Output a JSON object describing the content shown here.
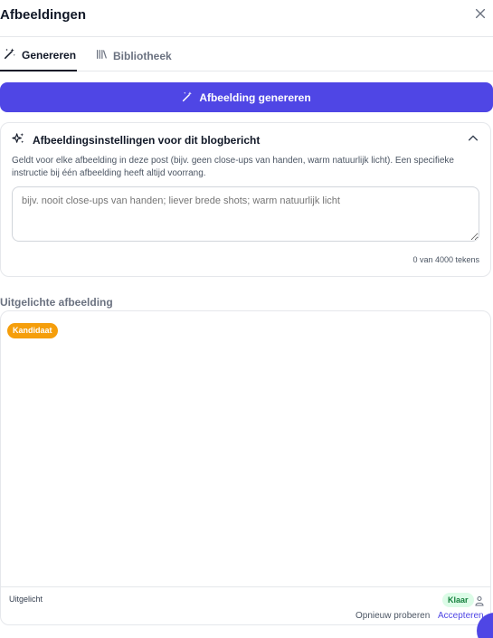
{
  "header": {
    "title": "Afbeeldingen",
    "close_icon": "close-icon"
  },
  "tabs": [
    {
      "label": "Genereren",
      "icon": "wand-icon",
      "active": true
    },
    {
      "label": "Bibliotheek",
      "icon": "library-icon",
      "active": false
    }
  ],
  "generate_button": {
    "label": "Afbeelding genereren",
    "icon": "wand-icon"
  },
  "settings": {
    "title": "Afbeeldingsinstellingen voor dit blogbericht",
    "icon": "sparkles-icon",
    "description": "Geldt voor elke afbeelding in deze post (bijv. geen close-ups van handen, warm natuurlijk licht). Een specifieke instructie bij één afbeelding heeft altijd voorrang.",
    "input_value": "",
    "input_placeholder": "bijv. nooit close-ups van handen; liever brede shots; warm natuurlijk licht",
    "char_count": "0 van 4000 tekens"
  },
  "featured": {
    "section_label": "Uitgelichte afbeelding",
    "candidate_badge": "Kandidaat",
    "type_label": "Uitgelicht",
    "status_badge": "Klaar",
    "retry_label": "Opnieuw proberen",
    "accept_label": "Accepteren"
  },
  "colors": {
    "accent": "#4f46e5",
    "candidate": "#f59e0b",
    "ready_bg": "#dcfce7",
    "ready_text": "#15803d"
  }
}
